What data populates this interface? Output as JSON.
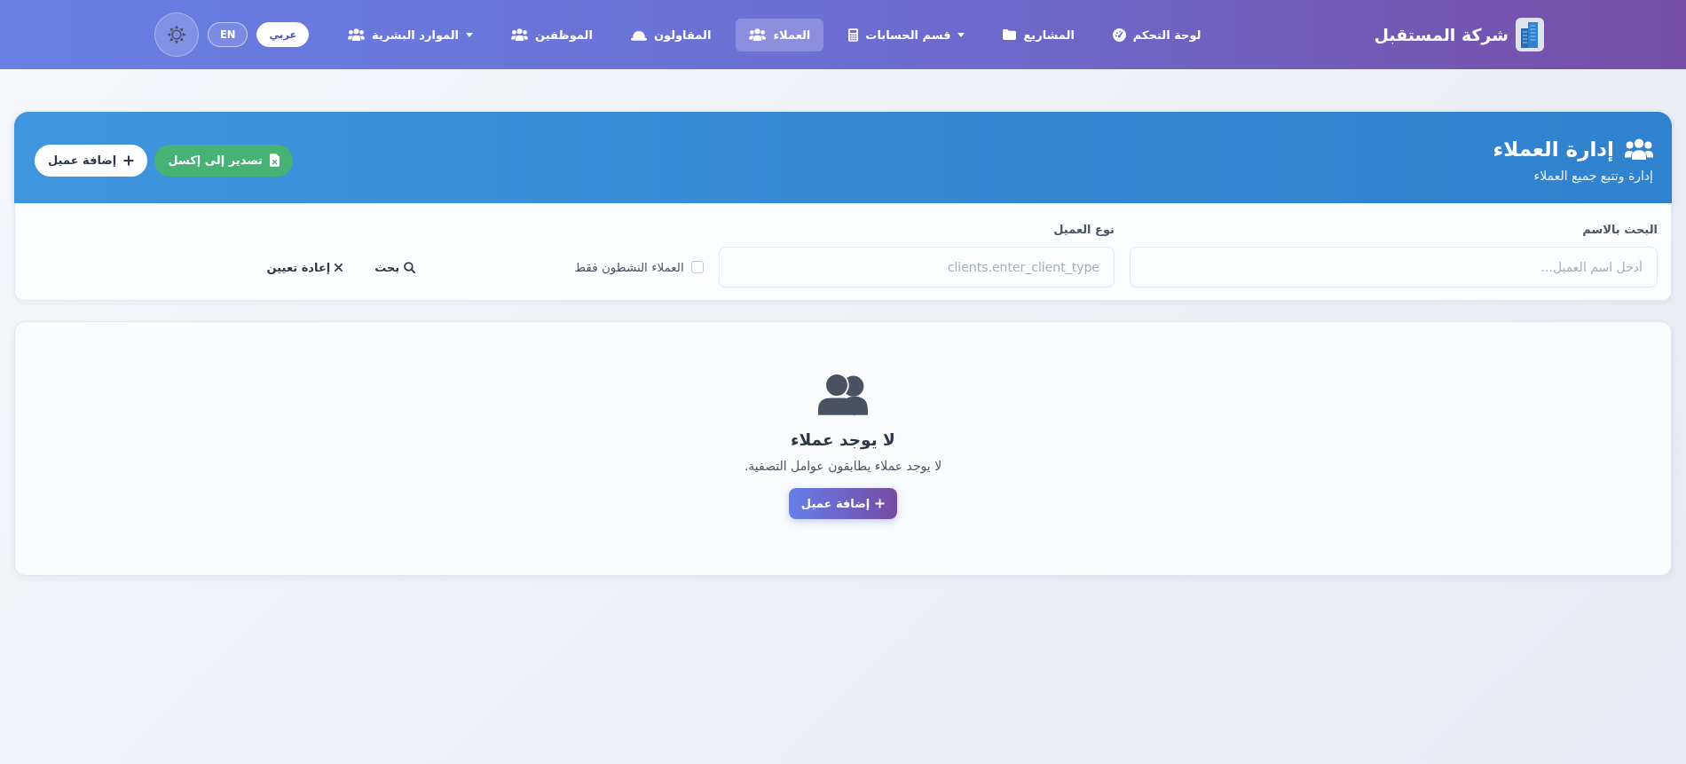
{
  "navbar": {
    "brand": "شركة المستقبل",
    "items": [
      {
        "label": "لوحة التحكم",
        "kind": "link",
        "selected": false
      },
      {
        "label": "المشاريع",
        "kind": "link",
        "selected": false
      },
      {
        "label": "قسم الحسابات",
        "kind": "dropdown",
        "selected": false
      },
      {
        "label": "العملاء",
        "kind": "link",
        "selected": true
      },
      {
        "label": "المقاولون",
        "kind": "link",
        "selected": false
      },
      {
        "label": "الموظفين",
        "kind": "link",
        "selected": false
      },
      {
        "label": "الموارد البشرية",
        "kind": "dropdown",
        "selected": false
      }
    ],
    "languages": [
      {
        "label": "عربي",
        "selected": true
      },
      {
        "label": "EN",
        "selected": false
      }
    ]
  },
  "header": {
    "title": "إدارة العملاء",
    "subtitle": "إدارة وتتبع جميع العملاء",
    "buttons": [
      {
        "label": "تصدير إلى إكسل",
        "kind": "export"
      },
      {
        "label": "إضافة عميل",
        "kind": "add"
      }
    ]
  },
  "filters": {
    "fields": [
      {
        "label": "البحث بالاسم",
        "placeholder": "أدخل اسم العميل..."
      },
      {
        "label": "نوع العميل",
        "placeholder": "clients.enter_client_type"
      }
    ],
    "active_only": {
      "label": "العملاء النشطون فقط",
      "checked": false
    },
    "actions": [
      {
        "label": "بحث",
        "kind": "search"
      },
      {
        "label": "إعادة تعيين",
        "kind": "reset"
      }
    ]
  },
  "empty_state": {
    "title": "لا يوجد عملاء",
    "message": "لا يوجد عملاء يطابقون عوامل التصفية.",
    "button": "إضافة عميل"
  }
}
